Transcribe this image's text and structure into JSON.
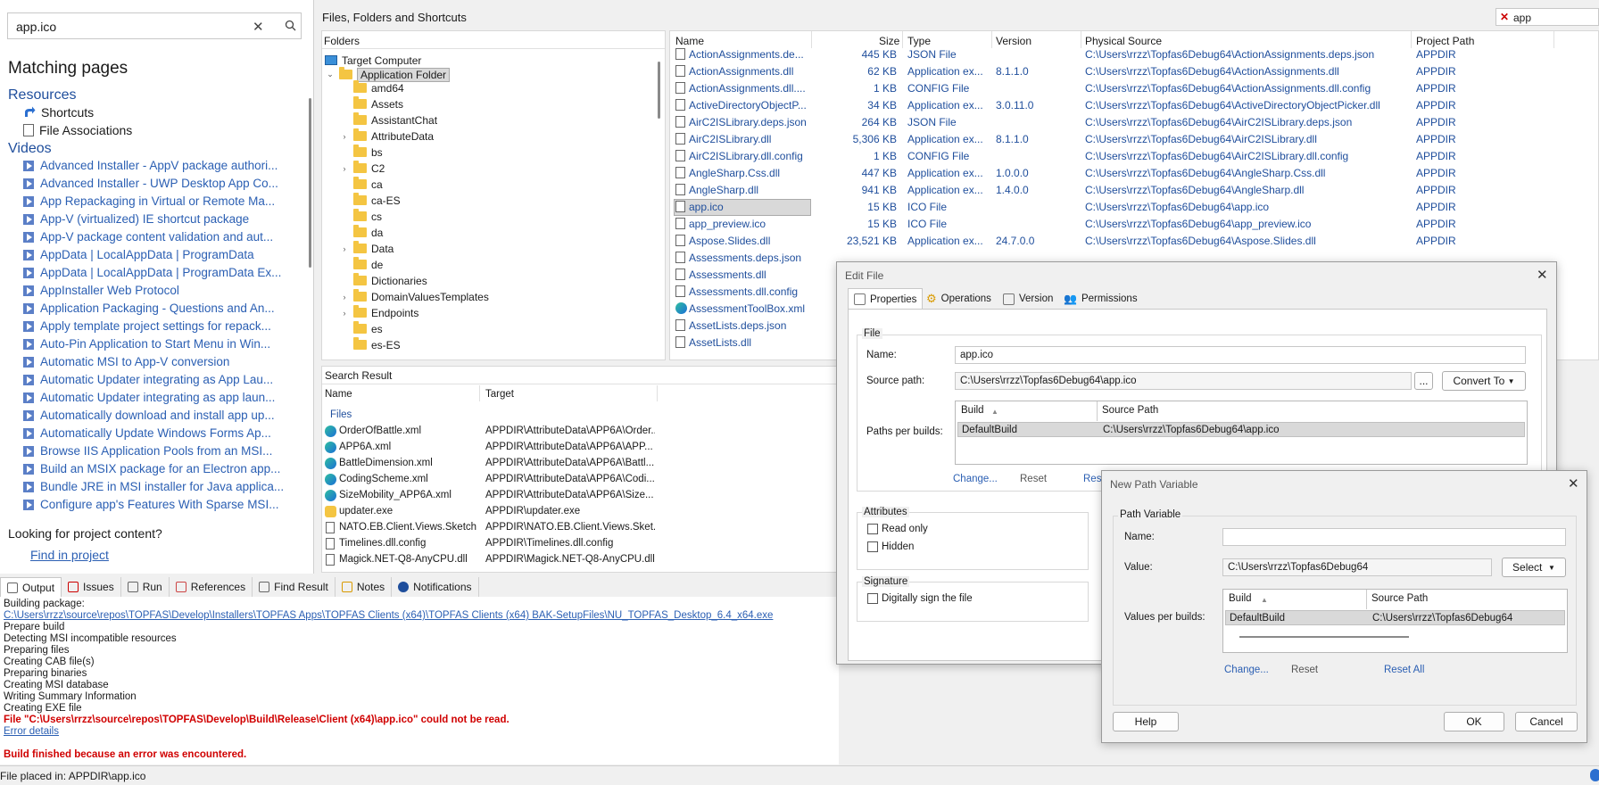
{
  "help": {
    "search_value": "app.ico",
    "matching_title": "Matching pages",
    "resources_heading": "Resources",
    "resources": [
      "Shortcuts",
      "File Associations"
    ],
    "videos_heading": "Videos",
    "videos": [
      "Advanced Installer - AppV package authori...",
      "Advanced Installer - UWP Desktop App Co...",
      "App Repackaging in Virtual or Remote Ma...",
      "App-V (virtualized) IE shortcut package",
      "App-V package content validation and aut...",
      "AppData | LocalAppData | ProgramData",
      "AppData | LocalAppData | ProgramData Ex...",
      "AppInstaller Web Protocol",
      "Application Packaging - Questions and An...",
      "Apply template project settings for repack...",
      "Auto-Pin Application to Start Menu in Win...",
      "Automatic MSI to App-V conversion",
      "Automatic Updater integrating as App Lau...",
      "Automatic Updater integrating as app laun...",
      "Automatically download and install app up...",
      "Automatically Update Windows Forms Ap...",
      "Browse IIS Application Pools from an MSI...",
      "Build an MSIX package for an Electron app...",
      "Bundle JRE in MSI installer for Java applica...",
      "Configure app's Features With Sparse MSI..."
    ],
    "looking_text": "Looking for project content?",
    "find_link": "Find in project"
  },
  "main": {
    "title": "Files, Folders and Shortcuts",
    "filter_value": "app",
    "folders_header": "Folders",
    "tree_root": "Target Computer",
    "tree_app": "Application Folder",
    "tree_items": [
      {
        "label": "amd64",
        "expand": false
      },
      {
        "label": "Assets",
        "expand": false
      },
      {
        "label": "AssistantChat",
        "expand": false
      },
      {
        "label": "AttributeData",
        "expand": true
      },
      {
        "label": "bs",
        "expand": false
      },
      {
        "label": "C2",
        "expand": true
      },
      {
        "label": "ca",
        "expand": false
      },
      {
        "label": "ca-ES",
        "expand": false
      },
      {
        "label": "cs",
        "expand": false
      },
      {
        "label": "da",
        "expand": false
      },
      {
        "label": "Data",
        "expand": true
      },
      {
        "label": "de",
        "expand": false
      },
      {
        "label": "Dictionaries",
        "expand": false
      },
      {
        "label": "DomainValuesTemplates",
        "expand": true
      },
      {
        "label": "Endpoints",
        "expand": true
      },
      {
        "label": "es",
        "expand": false
      },
      {
        "label": "es-ES",
        "expand": false
      }
    ],
    "file_columns": [
      "Name",
      "Size",
      "Type",
      "Version",
      "Physical Source",
      "Project Path"
    ],
    "files": [
      {
        "name": "ActionAssignments.de...",
        "size": "445 KB",
        "type": "JSON File",
        "version": "",
        "source": "C:\\Users\\rrzz\\Topfas6Debug64\\ActionAssignments.deps.json",
        "path": "APPDIR"
      },
      {
        "name": "ActionAssignments.dll",
        "size": "62 KB",
        "type": "Application ex...",
        "version": "8.1.1.0",
        "source": "C:\\Users\\rrzz\\Topfas6Debug64\\ActionAssignments.dll",
        "path": "APPDIR"
      },
      {
        "name": "ActionAssignments.dll....",
        "size": "1 KB",
        "type": "CONFIG File",
        "version": "",
        "source": "C:\\Users\\rrzz\\Topfas6Debug64\\ActionAssignments.dll.config",
        "path": "APPDIR"
      },
      {
        "name": "ActiveDirectoryObjectP...",
        "size": "34 KB",
        "type": "Application ex...",
        "version": "3.0.11.0",
        "source": "C:\\Users\\rrzz\\Topfas6Debug64\\ActiveDirectoryObjectPicker.dll",
        "path": "APPDIR"
      },
      {
        "name": "AirC2ISLibrary.deps.json",
        "size": "264 KB",
        "type": "JSON File",
        "version": "",
        "source": "C:\\Users\\rrzz\\Topfas6Debug64\\AirC2ISLibrary.deps.json",
        "path": "APPDIR"
      },
      {
        "name": "AirC2ISLibrary.dll",
        "size": "5,306 KB",
        "type": "Application ex...",
        "version": "8.1.1.0",
        "source": "C:\\Users\\rrzz\\Topfas6Debug64\\AirC2ISLibrary.dll",
        "path": "APPDIR"
      },
      {
        "name": "AirC2ISLibrary.dll.config",
        "size": "1 KB",
        "type": "CONFIG File",
        "version": "",
        "source": "C:\\Users\\rrzz\\Topfas6Debug64\\AirC2ISLibrary.dll.config",
        "path": "APPDIR"
      },
      {
        "name": "AngleSharp.Css.dll",
        "size": "447 KB",
        "type": "Application ex...",
        "version": "1.0.0.0",
        "source": "C:\\Users\\rrzz\\Topfas6Debug64\\AngleSharp.Css.dll",
        "path": "APPDIR"
      },
      {
        "name": "AngleSharp.dll",
        "size": "941 KB",
        "type": "Application ex...",
        "version": "1.4.0.0",
        "source": "C:\\Users\\rrzz\\Topfas6Debug64\\AngleSharp.dll",
        "path": "APPDIR"
      },
      {
        "name": "app.ico",
        "size": "15 KB",
        "type": "ICO File",
        "version": "",
        "source": "C:\\Users\\rrzz\\Topfas6Debug64\\app.ico",
        "path": "APPDIR"
      },
      {
        "name": "app_preview.ico",
        "size": "15 KB",
        "type": "ICO File",
        "version": "",
        "source": "C:\\Users\\rrzz\\Topfas6Debug64\\app_preview.ico",
        "path": "APPDIR"
      },
      {
        "name": "Aspose.Slides.dll",
        "size": "23,521 KB",
        "type": "Application ex...",
        "version": "24.7.0.0",
        "source": "C:\\Users\\rrzz\\Topfas6Debug64\\Aspose.Slides.dll",
        "path": "APPDIR"
      },
      {
        "name": "Assessments.deps.json",
        "size": "",
        "type": "",
        "version": "",
        "source": "",
        "path": ""
      },
      {
        "name": "Assessments.dll",
        "size": "",
        "type": "",
        "version": "",
        "source": "",
        "path": ""
      },
      {
        "name": "Assessments.dll.config",
        "size": "",
        "type": "",
        "version": "",
        "source": "",
        "path": ""
      },
      {
        "name": "AssessmentToolBox.xml",
        "size": "",
        "type": "",
        "version": "",
        "source": "",
        "path": ""
      },
      {
        "name": "AssetLists.deps.json",
        "size": "",
        "type": "",
        "version": "",
        "source": "",
        "path": ""
      },
      {
        "name": "AssetLists.dll",
        "size": "",
        "type": "",
        "version": "",
        "source": "",
        "path": ""
      }
    ],
    "selected_file": "app.ico"
  },
  "search_result": {
    "title": "Search Result",
    "col_name": "Name",
    "col_target": "Target",
    "group": "Files",
    "rows": [
      {
        "name": "OrderOfBattle.xml",
        "target": "APPDIR\\AttributeData\\APP6A\\Order..."
      },
      {
        "name": "APP6A.xml",
        "target": "APPDIR\\AttributeData\\APP6A\\APP..."
      },
      {
        "name": "BattleDimension.xml",
        "target": "APPDIR\\AttributeData\\APP6A\\Battl..."
      },
      {
        "name": "CodingScheme.xml",
        "target": "APPDIR\\AttributeData\\APP6A\\Codi..."
      },
      {
        "name": "SizeMobility_APP6A.xml",
        "target": "APPDIR\\AttributeData\\APP6A\\Size..."
      },
      {
        "name": "updater.exe",
        "target": "APPDIR\\updater.exe"
      },
      {
        "name": "NATO.EB.Client.Views.Sketch...",
        "target": "APPDIR\\NATO.EB.Client.Views.Sket..."
      },
      {
        "name": "Timelines.dll.config",
        "target": "APPDIR\\Timelines.dll.config"
      },
      {
        "name": "Magick.NET-Q8-AnyCPU.dll",
        "target": "APPDIR\\Magick.NET-Q8-AnyCPU.dll"
      }
    ]
  },
  "bottom_tabs": [
    "Output",
    "Issues",
    "Run",
    "References",
    "Find Result",
    "Notes",
    "Notifications"
  ],
  "output": {
    "lines": [
      "Building package:",
      "Prepare build",
      "Detecting MSI incompatible resources",
      "Preparing files",
      "Creating CAB file(s)",
      "Preparing binaries",
      "Creating MSI database",
      "Writing Summary Information",
      "Creating EXE file"
    ],
    "package_link": "C:\\Users\\rrzz\\source\\repos\\TOPFAS\\Develop\\Installers\\TOPFAS Apps\\TOPFAS Clients (x64)\\TOPFAS Clients (x64) BAK-SetupFiles\\NU_TOPFAS_Desktop_6.4_x64.exe",
    "error_line": "File \"C:\\Users\\rrzz\\source\\repos\\TOPFAS\\Develop\\Build\\Release\\Client (x64)\\app.ico\" could not be read.",
    "error_details": "Error details",
    "build_finished": "Build finished because an error was encountered."
  },
  "status": {
    "text": "File placed in: APPDIR\\app.ico"
  },
  "edit_file": {
    "title": "Edit File",
    "tabs": [
      "Properties",
      "Operations",
      "Version",
      "Permissions"
    ],
    "group_file": "File",
    "name_label": "Name:",
    "name_value": "app.ico",
    "source_label": "Source path:",
    "source_value": "C:\\Users\\rrzz\\Topfas6Debug64\\app.ico",
    "browse": "...",
    "convert": "Convert To",
    "paths_label": "Paths per builds:",
    "col_build": "Build",
    "col_source": "Source Path",
    "row_build": "DefaultBuild",
    "row_source": "C:\\Users\\rrzz\\Topfas6Debug64\\app.ico",
    "change": "Change...",
    "reset": "Reset",
    "reset_all": "Rese",
    "group_attributes": "Attributes",
    "read_only": "Read only",
    "hidden": "Hidden",
    "group_signature": "Signature",
    "sign": "Digitally sign the file"
  },
  "new_path": {
    "title": "New Path Variable",
    "group": "Path Variable",
    "name_label": "Name:",
    "name_value": "",
    "value_label": "Value:",
    "value_value": "C:\\Users\\rrzz\\Topfas6Debug64",
    "select": "Select",
    "values_label": "Values per builds:",
    "col_build": "Build",
    "col_source": "Source Path",
    "row_build": "DefaultBuild",
    "row_source": "C:\\Users\\rrzz\\Topfas6Debug64",
    "change": "Change...",
    "reset": "Reset",
    "reset_all": "Reset All",
    "help": "Help",
    "ok": "OK",
    "cancel": "Cancel"
  }
}
